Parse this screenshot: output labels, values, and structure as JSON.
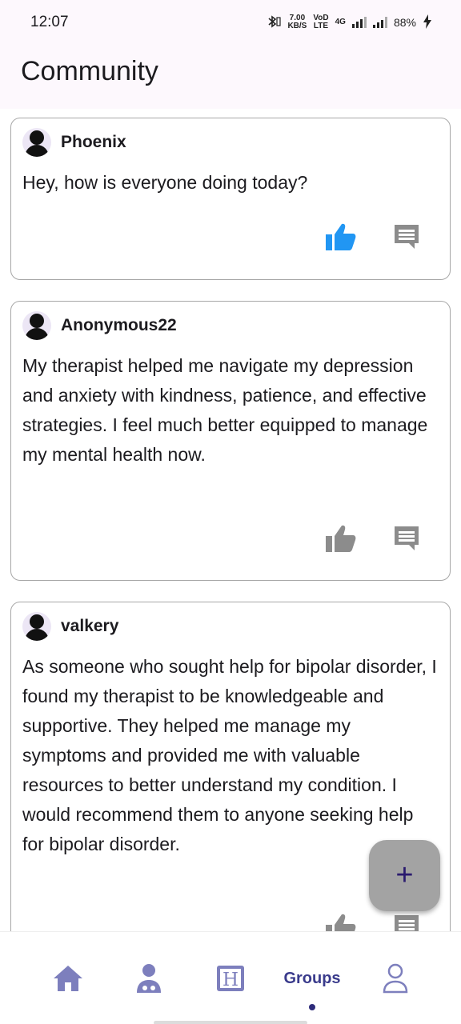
{
  "status_bar": {
    "time": "12:07",
    "speed_value": "7.00",
    "speed_unit": "KB/S",
    "volte": "VoD",
    "lte": "LTE",
    "network": "4G",
    "battery": "88%"
  },
  "app_bar": {
    "title": "Community"
  },
  "posts": [
    {
      "author": "Phoenix",
      "text": "Hey, how is everyone doing today?",
      "liked": true
    },
    {
      "author": "Anonymous22",
      "text": "My therapist helped me navigate my depression and anxiety with kindness, patience, and effective strategies. I feel much better equipped to manage my mental health now.",
      "liked": false
    },
    {
      "author": "valkery",
      "text": "As someone who sought help for bipolar disorder, I found my therapist to be knowledgeable and supportive. They helped me manage my symptoms and provided me with valuable resources to better understand my condition. I would recommend them to anyone seeking help for bipolar disorder.",
      "liked": false
    }
  ],
  "fab": {
    "icon": "plus-icon",
    "glyph": "+"
  },
  "bottom_nav": {
    "items": [
      {
        "icon": "home-icon"
      },
      {
        "icon": "doctor-icon"
      },
      {
        "icon": "hospital-icon",
        "glyph": "H"
      },
      {
        "label": "Groups",
        "active": true
      },
      {
        "icon": "profile-icon"
      }
    ]
  },
  "colors": {
    "liked": "#2196f3",
    "icon_gray": "#8c8c8c",
    "nav_icon": "#7d7fbd",
    "accent": "#3a3b8c"
  }
}
